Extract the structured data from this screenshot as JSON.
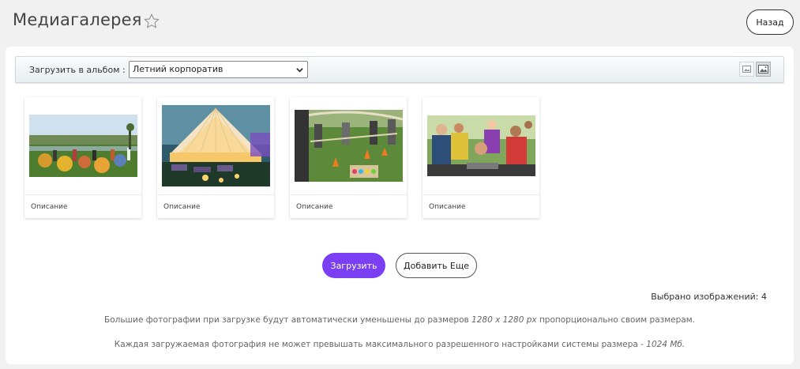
{
  "header": {
    "title": "Медиагалерея",
    "back_label": "Назад"
  },
  "toolbar": {
    "upload_label": "Загрузить в альбом :",
    "album_selected": "Летний корпоратив",
    "view_modes": [
      "small-thumbnails-icon",
      "large-thumbnails-icon"
    ],
    "active_view": "large-thumbnails-icon"
  },
  "gallery": {
    "items": [
      {
        "description": "Описание",
        "photo": "outdoor-party-beanbags"
      },
      {
        "description": "Описание",
        "photo": "festival-tent-lights"
      },
      {
        "description": "Описание",
        "photo": "team-building-game"
      },
      {
        "description": "Описание",
        "photo": "friends-hands-together"
      }
    ]
  },
  "actions": {
    "upload_label": "Загрузить",
    "add_more_label": "Добавить Еще"
  },
  "status": {
    "selected_text": "Выбрано изображений: 4"
  },
  "notes": {
    "resize_prefix": "Большие фотографии при загрузке будут автоматически уменьшены до размеров ",
    "resize_size": "1280 x 1280 px",
    "resize_suffix": " пропорционально своим размерам.",
    "limit_prefix": "Каждая загружаемая фотография не может превышать максимального разрешенного настройками системы размера - ",
    "limit_size": "1024 Мб."
  },
  "colors": {
    "accent": "#7a3ff2",
    "background": "#f1f1f1"
  }
}
